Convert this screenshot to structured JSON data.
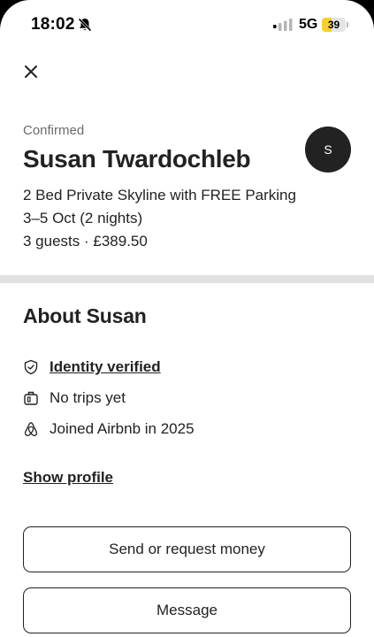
{
  "status_bar": {
    "time": "18:02",
    "network": "5G",
    "battery": "39",
    "battery_level": 0.39
  },
  "reservation": {
    "status": "Confirmed",
    "guest_name": "Susan Twardochleb",
    "avatar_initial": "S",
    "listing": "2 Bed Private Skyline with FREE Parking",
    "dates": "3–5 Oct (2 nights)",
    "guests_price": "3 guests · £389.50"
  },
  "about": {
    "title": "About Susan",
    "items": [
      {
        "icon": "shield-check-icon",
        "label": "Identity verified"
      },
      {
        "icon": "suitcase-icon",
        "label": "No trips yet"
      },
      {
        "icon": "airbnb-logo-icon",
        "label": "Joined Airbnb in 2025"
      }
    ],
    "show_profile": "Show profile"
  },
  "actions": {
    "send_money": "Send or request money",
    "message": "Message"
  },
  "colors": {
    "text": "#222222",
    "muted": "#6a6a6a",
    "divider": "#e0e0e0",
    "battery": "#f7d02a"
  }
}
